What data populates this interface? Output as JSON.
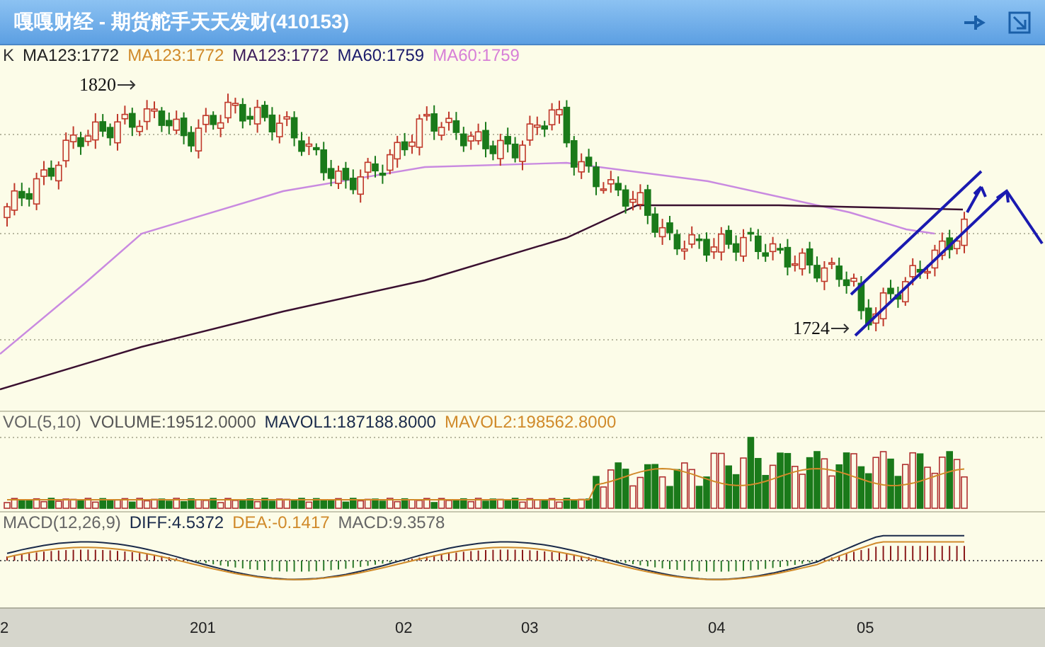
{
  "window": {
    "title": "嘎嘎财经 - 期货舵手天天发财(410153)"
  },
  "main_legend": [
    {
      "text": "K",
      "color": "#333333"
    },
    {
      "text": "MA123:1772",
      "color": "#222222"
    },
    {
      "text": "MA123:1772",
      "color": "#d08a2a"
    },
    {
      "text": "MA123:1772",
      "color": "#3a1a5a"
    },
    {
      "text": "MA60:1759",
      "color": "#1a1a6a"
    },
    {
      "text": "MA60:1759",
      "color": "#d77fd7"
    }
  ],
  "annotations": [
    {
      "text": "1820"
    },
    {
      "text": "1724"
    }
  ],
  "volume_legend": [
    {
      "text": "VOL(5,10)",
      "color": "#666666"
    },
    {
      "text": "VOLUME:19512.0000",
      "color": "#555555"
    },
    {
      "text": "MAVOL1:187188.8000",
      "color": "#1a2a4a"
    },
    {
      "text": "MAVOL2:198562.8000",
      "color": "#d08a2a"
    }
  ],
  "macd_legend": [
    {
      "text": "MACD(12,26,9)",
      "color": "#666666"
    },
    {
      "text": "DIFF:4.5372",
      "color": "#1a2a4a"
    },
    {
      "text": "DEA:-0.1417",
      "color": "#d08a2a"
    },
    {
      "text": "MACD:9.3578",
      "color": "#666666"
    }
  ],
  "x_axis": [
    "2",
    "201",
    "02",
    "03",
    "04",
    "05"
  ]
}
